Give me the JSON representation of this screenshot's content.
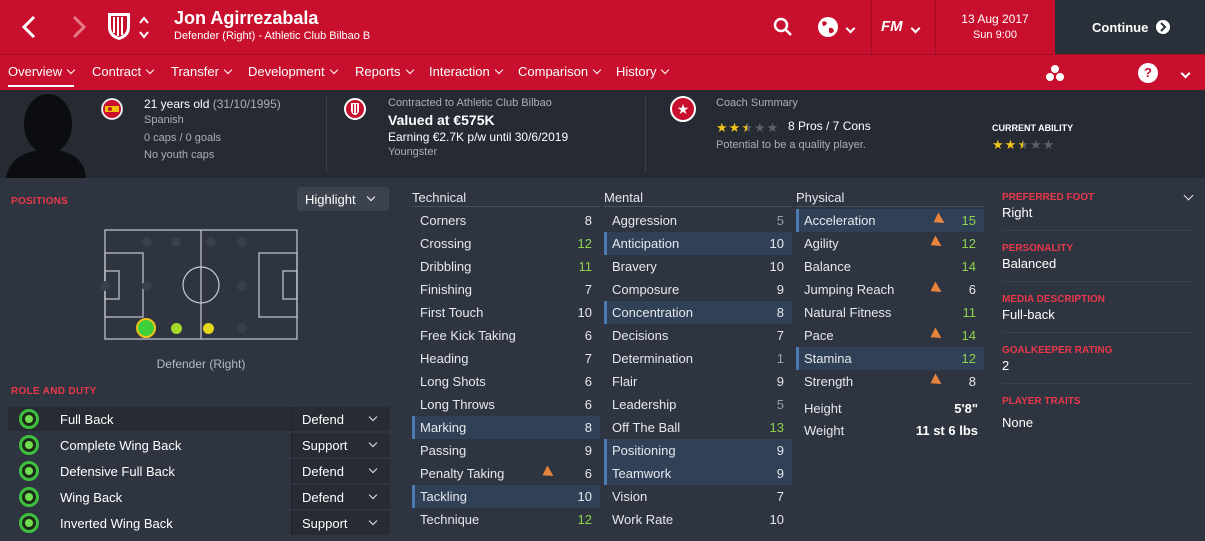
{
  "header": {
    "player_name": "Jon Agirrezabala",
    "player_subtitle": "Defender (Right) - Athletic Club Bilbao B",
    "date": "13 Aug 2017",
    "day_time": "Sun 9:00",
    "continue_label": "Continue",
    "fm_logo": "FM"
  },
  "nav": {
    "tabs": [
      "Overview",
      "Contract",
      "Transfer",
      "Development",
      "Reports",
      "Interaction",
      "Comparison",
      "History"
    ]
  },
  "info": {
    "age": "21 years old",
    "dob": "(31/10/1995)",
    "nationality": "Spanish",
    "caps": "0 caps / 0 goals",
    "youth_caps": "No youth caps",
    "contract": "Contracted to Athletic Club Bilbao",
    "value": "Valued at €575K",
    "earning": "Earning €2.7K p/w until 30/6/2019",
    "status": "Youngster",
    "coach_title": "Coach Summary",
    "coach_pros": "8 Pros / 7 Cons",
    "coach_potential": "Potential to be a quality player.",
    "current_ability_label": "CURRENT ABILITY",
    "coach_stars": 2.5,
    "current_ability_stars": 2.5
  },
  "positions": {
    "label": "POSITIONS",
    "highlight": "Highlight",
    "position_name": "Defender (Right)"
  },
  "roles": {
    "label": "ROLE AND DUTY",
    "items": [
      {
        "role": "Full Back",
        "duty": "Defend"
      },
      {
        "role": "Complete Wing Back",
        "duty": "Support"
      },
      {
        "role": "Defensive Full Back",
        "duty": "Defend"
      },
      {
        "role": "Wing Back",
        "duty": "Defend"
      },
      {
        "role": "Inverted Wing Back",
        "duty": "Support"
      }
    ]
  },
  "technical": {
    "title": "Technical",
    "attrs": [
      {
        "name": "Corners",
        "value": "8"
      },
      {
        "name": "Crossing",
        "value": "12"
      },
      {
        "name": "Dribbling",
        "value": "11"
      },
      {
        "name": "Finishing",
        "value": "7"
      },
      {
        "name": "First Touch",
        "value": "10"
      },
      {
        "name": "Free Kick Taking",
        "value": "6"
      },
      {
        "name": "Heading",
        "value": "7"
      },
      {
        "name": "Long Shots",
        "value": "6"
      },
      {
        "name": "Long Throws",
        "value": "6"
      },
      {
        "name": "Marking",
        "value": "8"
      },
      {
        "name": "Passing",
        "value": "9"
      },
      {
        "name": "Penalty Taking",
        "value": "6"
      },
      {
        "name": "Tackling",
        "value": "10"
      },
      {
        "name": "Technique",
        "value": "12"
      }
    ]
  },
  "mental": {
    "title": "Mental",
    "attrs": [
      {
        "name": "Aggression",
        "value": "5"
      },
      {
        "name": "Anticipation",
        "value": "10"
      },
      {
        "name": "Bravery",
        "value": "10"
      },
      {
        "name": "Composure",
        "value": "9"
      },
      {
        "name": "Concentration",
        "value": "8"
      },
      {
        "name": "Decisions",
        "value": "7"
      },
      {
        "name": "Determination",
        "value": "1"
      },
      {
        "name": "Flair",
        "value": "9"
      },
      {
        "name": "Leadership",
        "value": "5"
      },
      {
        "name": "Off The Ball",
        "value": "13"
      },
      {
        "name": "Positioning",
        "value": "9"
      },
      {
        "name": "Teamwork",
        "value": "9"
      },
      {
        "name": "Vision",
        "value": "7"
      },
      {
        "name": "Work Rate",
        "value": "10"
      }
    ]
  },
  "physical": {
    "title": "Physical",
    "attrs": [
      {
        "name": "Acceleration",
        "value": "15"
      },
      {
        "name": "Agility",
        "value": "12"
      },
      {
        "name": "Balance",
        "value": "14"
      },
      {
        "name": "Jumping Reach",
        "value": "6"
      },
      {
        "name": "Natural Fitness",
        "value": "11"
      },
      {
        "name": "Pace",
        "value": "14"
      },
      {
        "name": "Stamina",
        "value": "12"
      },
      {
        "name": "Strength",
        "value": "8"
      }
    ],
    "height_label": "Height",
    "height": "5'8\"",
    "weight_label": "Weight",
    "weight": "11 st 6 lbs"
  },
  "right_panel": {
    "preferred_foot_label": "PREFERRED FOOT",
    "preferred_foot": "Right",
    "personality_label": "PERSONALITY",
    "personality": "Balanced",
    "media_label": "MEDIA DESCRIPTION",
    "media": "Full-back",
    "gk_label": "GOALKEEPER RATING",
    "gk": "2",
    "traits_label": "PLAYER TRAITS",
    "traits": "None"
  },
  "colors": {
    "brand_red": "#c8102e",
    "background": "#2e3440",
    "info_bg": "#252a33",
    "accent_green": "#8fd24c",
    "highlight_blue": "#2f4057",
    "star_gold": "#f0c419"
  }
}
